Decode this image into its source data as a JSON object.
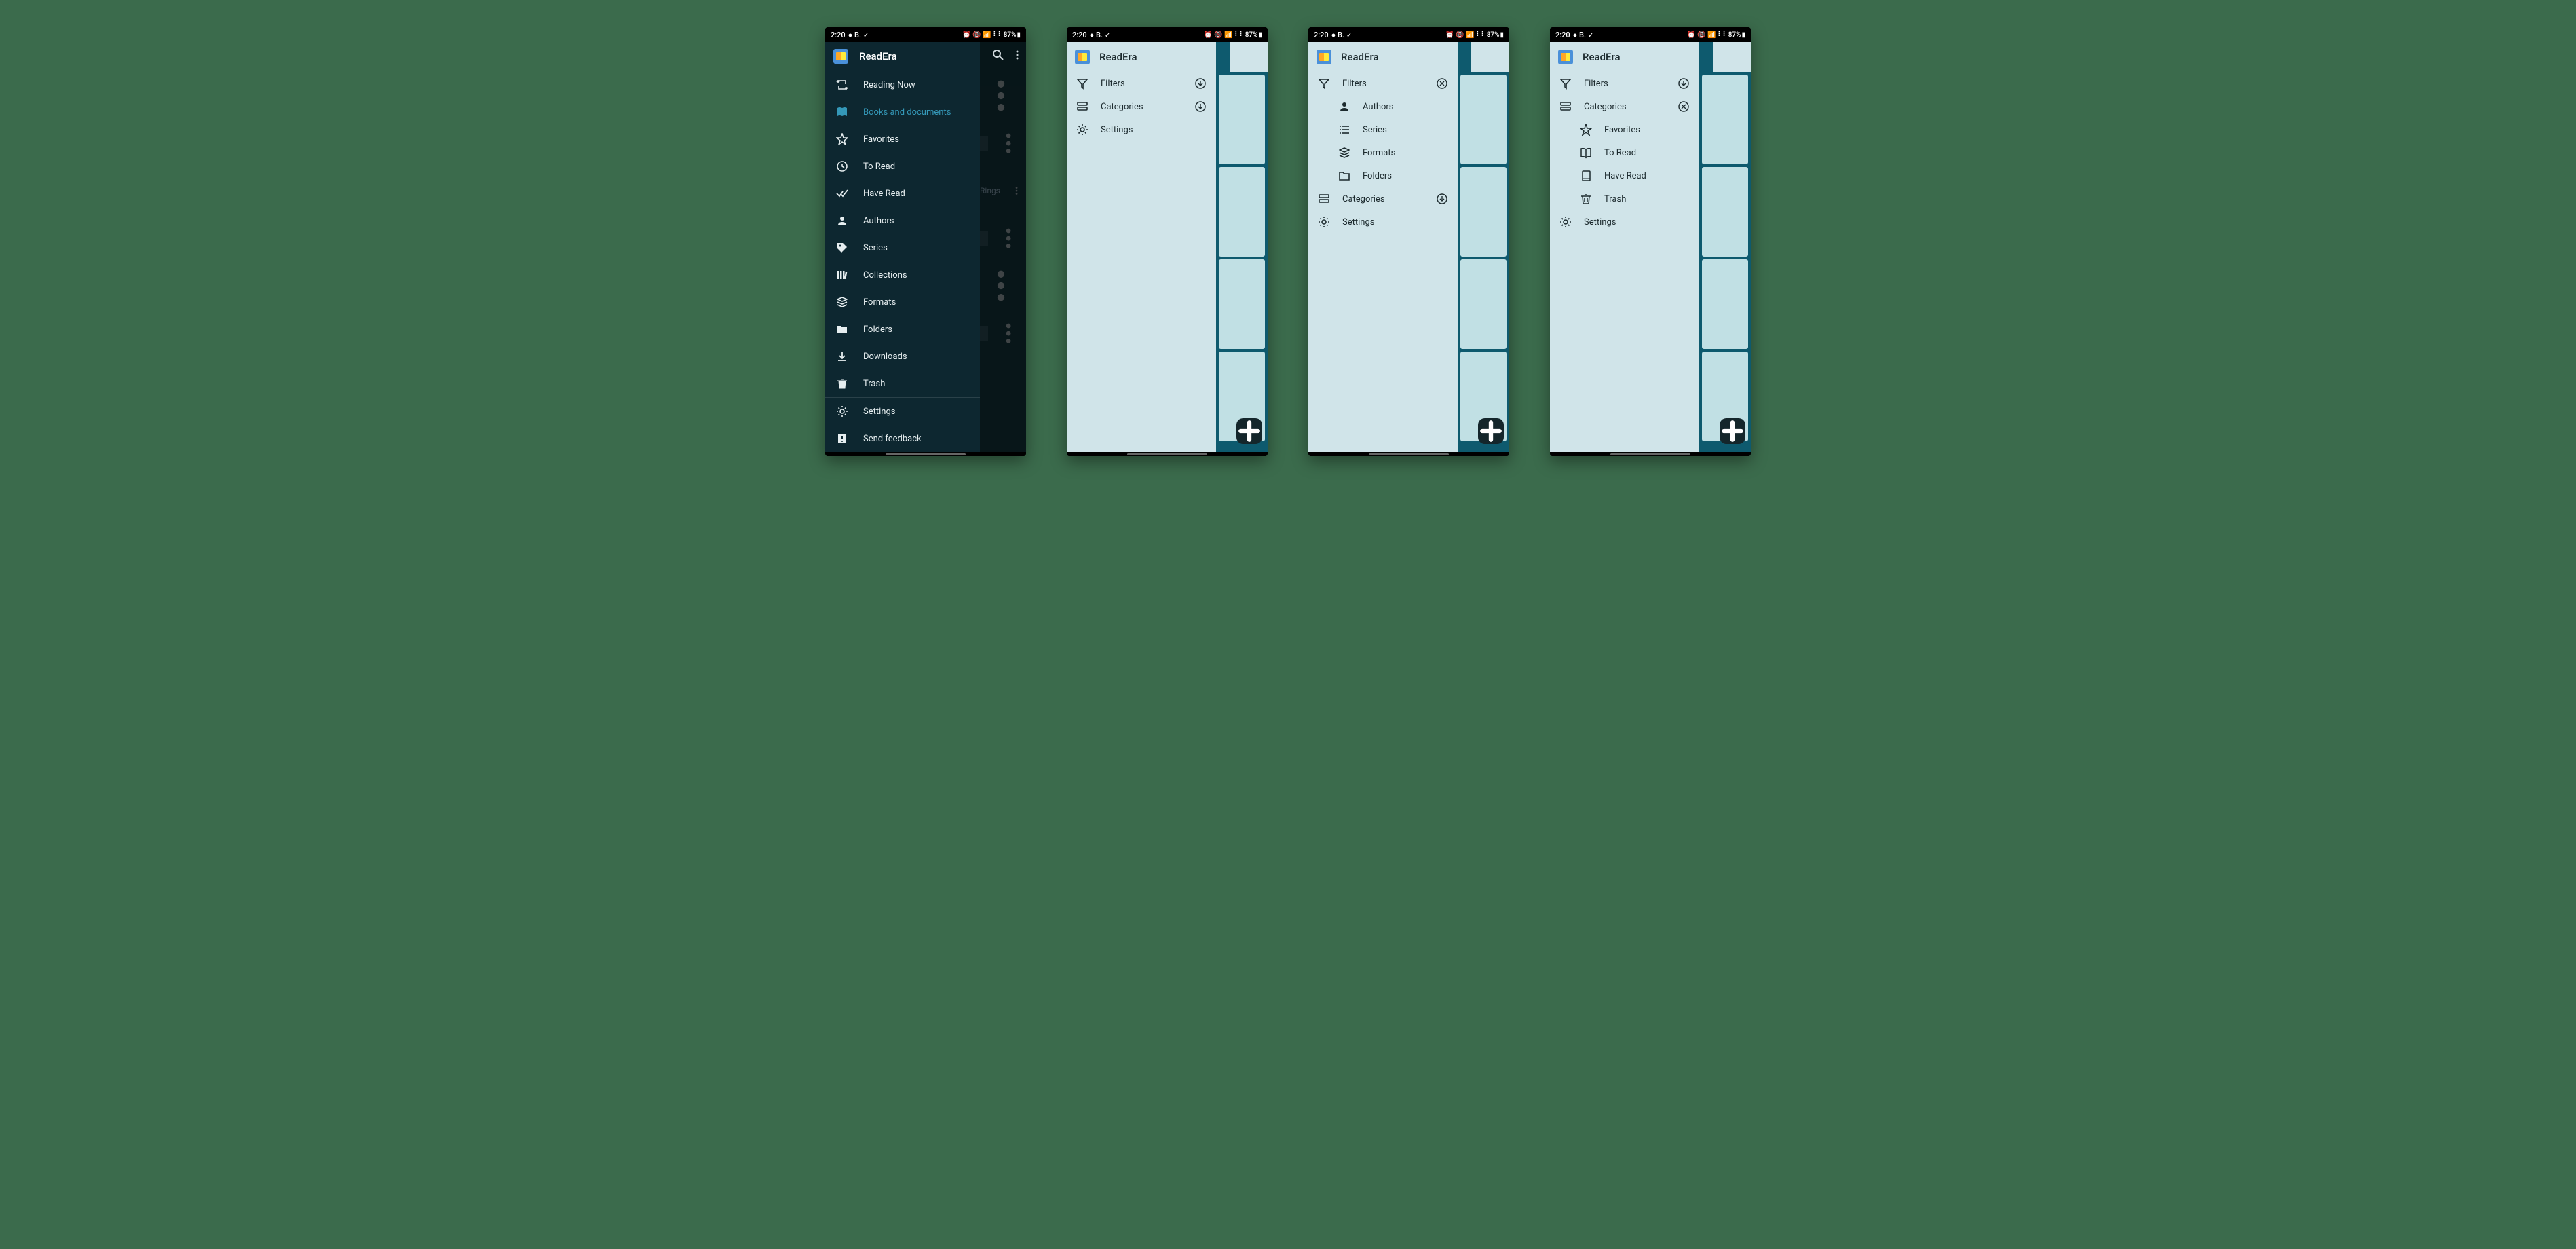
{
  "status": {
    "time": "2:20",
    "battery": "87%"
  },
  "app": {
    "title": "ReadEra"
  },
  "p1": {
    "items": [
      {
        "icon": "repeat-icon",
        "label": "Reading Now",
        "active": false
      },
      {
        "icon": "book-icon",
        "label": "Books and documents",
        "active": true
      },
      {
        "icon": "star-icon",
        "label": "Favorites",
        "active": false
      },
      {
        "icon": "clock-icon",
        "label": "To Read",
        "active": false
      },
      {
        "icon": "check-double-icon",
        "label": "Have Read",
        "active": false
      },
      {
        "icon": "person-icon",
        "label": "Authors",
        "active": false
      },
      {
        "icon": "tag-icon",
        "label": "Series",
        "active": false
      },
      {
        "icon": "library-icon",
        "label": "Collections",
        "active": false
      },
      {
        "icon": "stack-icon",
        "label": "Formats",
        "active": false
      },
      {
        "icon": "folder-icon",
        "label": "Folders",
        "active": false
      },
      {
        "icon": "download-icon",
        "label": "Downloads",
        "active": false
      },
      {
        "icon": "trash-icon",
        "label": "Trash",
        "active": false
      }
    ],
    "footer": [
      {
        "icon": "gear-icon",
        "label": "Settings"
      },
      {
        "icon": "alert-icon",
        "label": "Send feedback"
      }
    ],
    "backdrop_hint": "Rings"
  },
  "p2": {
    "items": [
      {
        "icon": "filter-icon",
        "label": "Filters",
        "right": "expand-down-icon",
        "sub": false
      },
      {
        "icon": "categories-icon",
        "label": "Categories",
        "right": "expand-down-icon",
        "sub": false
      },
      {
        "icon": "gear-icon",
        "label": "Settings",
        "right": null,
        "sub": false
      }
    ]
  },
  "p3": {
    "items": [
      {
        "icon": "filter-icon",
        "label": "Filters",
        "right": "close-circle-icon",
        "sub": false
      },
      {
        "icon": "person-icon",
        "label": "Authors",
        "right": null,
        "sub": true
      },
      {
        "icon": "list-icon",
        "label": "Series",
        "right": null,
        "sub": true
      },
      {
        "icon": "stack-icon",
        "label": "Formats",
        "right": null,
        "sub": true
      },
      {
        "icon": "folder-outline-icon",
        "label": "Folders",
        "right": null,
        "sub": true
      },
      {
        "icon": "categories-icon",
        "label": "Categories",
        "right": "expand-down-icon",
        "sub": false
      },
      {
        "icon": "gear-icon",
        "label": "Settings",
        "right": null,
        "sub": false
      }
    ]
  },
  "p4": {
    "items": [
      {
        "icon": "filter-icon",
        "label": "Filters",
        "right": "expand-down-icon",
        "sub": false
      },
      {
        "icon": "categories-icon",
        "label": "Categories",
        "right": "close-circle-icon",
        "sub": false
      },
      {
        "icon": "star-outline-icon",
        "label": "Favorites",
        "right": null,
        "sub": true
      },
      {
        "icon": "book-open-icon",
        "label": "To Read",
        "right": null,
        "sub": true
      },
      {
        "icon": "book-outline-icon",
        "label": "Have Read",
        "right": null,
        "sub": true
      },
      {
        "icon": "trash-outline-icon",
        "label": "Trash",
        "right": null,
        "sub": true
      },
      {
        "icon": "gear-icon",
        "label": "Settings",
        "right": null,
        "sub": false
      }
    ]
  }
}
